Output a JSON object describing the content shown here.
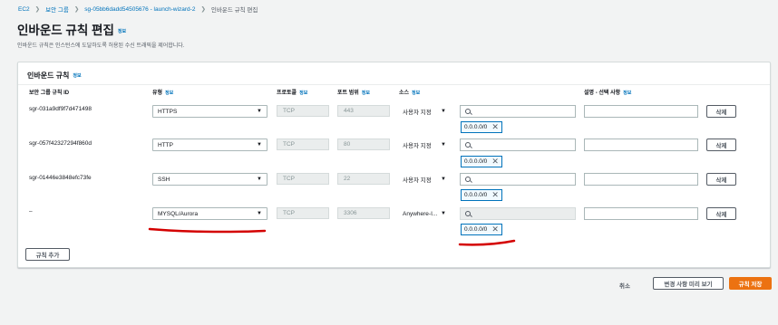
{
  "breadcrumb": {
    "items": [
      "EC2",
      "보안 그룹",
      "sg-05bb6dadd54505676 - launch-wizard-2"
    ],
    "current": "인바운드 규칙 편집"
  },
  "page": {
    "title": "인바운드 규칙 편집",
    "info": "정보",
    "description": "인바운드 규칙은 인스턴스에 도달하도록 허용된 수신 트래픽을 제어합니다."
  },
  "panel": {
    "title": "인바운드 규칙",
    "info": "정보",
    "columns": {
      "rule_id": "보안 그룹 규칙 ID",
      "type": "유형",
      "protocol": "프로토콜",
      "port_range": "포트 범위",
      "source": "소스",
      "description": "설명 - 선택 사항",
      "info": "정보"
    },
    "rows": [
      {
        "id": "sgr-031a9df9f7d471498",
        "type": "HTTPS",
        "protocol": "TCP",
        "port": "443",
        "source": "사용자 지정",
        "cidr": "0.0.0.0/0",
        "delete": "삭제"
      },
      {
        "id": "sgr-057f42327294f860d",
        "type": "HTTP",
        "protocol": "TCP",
        "port": "80",
        "source": "사용자 지정",
        "cidr": "0.0.0.0/0",
        "delete": "삭제"
      },
      {
        "id": "sgr-01446e3848efc73fe",
        "type": "SSH",
        "protocol": "TCP",
        "port": "22",
        "source": "사용자 지정",
        "cidr": "0.0.0.0/0",
        "delete": "삭제"
      },
      {
        "id": "–",
        "type": "MYSQL/Aurora",
        "protocol": "TCP",
        "port": "3306",
        "source": "Anywhere-I...",
        "cidr": "0.0.0.0/0",
        "delete": "삭제"
      }
    ],
    "add_rule": "규칙 추가"
  },
  "footer": {
    "cancel": "취소",
    "preview": "변경 사항 미리 보기",
    "save": "규칙 저장"
  },
  "colors": {
    "accent": "#ec7211",
    "link": "#0073bb",
    "annotation": "#d40000"
  }
}
